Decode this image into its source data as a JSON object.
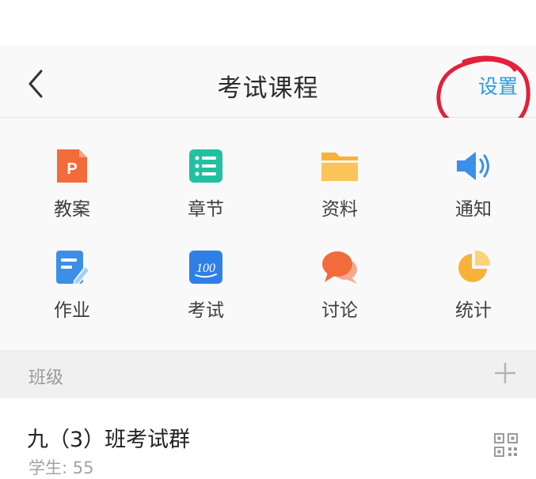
{
  "header": {
    "title": "考试课程",
    "settings_label": "设置",
    "back_icon": "chevron-left-icon",
    "accent_color": "#2a9bdf",
    "annotation_color": "#e3213a"
  },
  "features": [
    {
      "label": "教案",
      "icon": "ppt-file-icon",
      "color": "#f26b3a",
      "glyph": "P"
    },
    {
      "label": "章节",
      "icon": "list-icon",
      "color": "#22c0a0"
    },
    {
      "label": "资料",
      "icon": "folder-icon",
      "color": "#f8b23a"
    },
    {
      "label": "通知",
      "icon": "speaker-icon",
      "color": "#3b8fe8"
    },
    {
      "label": "作业",
      "icon": "edit-document-icon",
      "color": "#3b8fe8"
    },
    {
      "label": "考试",
      "icon": "score-100-icon",
      "color": "#2f7fe6",
      "glyph": "100"
    },
    {
      "label": "讨论",
      "icon": "chat-bubbles-icon",
      "color": "#f26b3a"
    },
    {
      "label": "统计",
      "icon": "pie-chart-icon",
      "color": "#f8b23a"
    }
  ],
  "section": {
    "title": "班级",
    "add_icon": "plus-icon"
  },
  "class_item": {
    "name": "九（3）班考试群",
    "students_text": "学生: 55",
    "qr_icon": "qr-code-icon"
  }
}
